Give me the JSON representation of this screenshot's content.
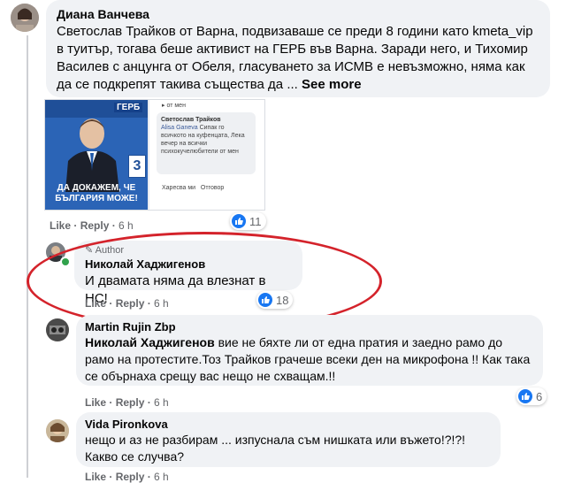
{
  "comment1": {
    "author": "Диана Ванчева",
    "text_main": "Светослав Трайков от Варна, подвизаваше се преди 8 години като kmeta_vip в туитър, тогава беше активист на ГЕРБ във Варна. Заради него, и Тихомир Василев с анцунга от Обеля, гласуването за ИСМВ е невъзможно, няма как да се подкрепят такива същества да ...",
    "see_more": "See more",
    "like": "Like",
    "reply": "Reply",
    "time": "6 h",
    "reactions": "11"
  },
  "attached_image": {
    "poster_logo": "ГЕРБ",
    "poster_slogan": "ДА ДОКАЖЕМ, ЧЕ БЪЛГАРИЯ МОЖЕ!",
    "poster_number": "3",
    "embedded_header": "от мен",
    "embedded_author": "Светослав Трайков",
    "embedded_mention": "Alisa Ganeva",
    "embedded_text": "Сипак го всичкото на куфенцата, Лека вечер на всички психокучелюбители от мен",
    "embedded_like": "Харесва ми",
    "embedded_reply": "Отговор"
  },
  "reply1": {
    "badge": "Author",
    "author": "Николай Хаджигенов",
    "text": "И двамата няма да влезнат в НС!",
    "like": "Like",
    "reply": "Reply",
    "time": "6 h",
    "reactions": "18"
  },
  "reply2": {
    "author": "Martin Rujin Zbp",
    "mention": "Николай Хаджигенов",
    "text": " вие не бяхте ли от една пратия и заедно рамо до рамо на протестите.Тоз Трайков грачеше всеки ден на микрофона !! Как така се обърнаха срещу вас нещо не схващам.!!",
    "like": "Like",
    "reply": "Reply",
    "time": "6 h",
    "reactions": "6"
  },
  "reply3": {
    "author": "Vida Pironkova",
    "text": "нещо и аз не разбирам ... изпуснала съм нишката или въжето!?!?! Какво се случва?",
    "like": "Like",
    "reply": "Reply",
    "time": "6 h"
  },
  "colors": {
    "bubble": "#f0f2f5",
    "meta": "#65676b",
    "like_blue": "#1877f2",
    "highlight": "#d4232b"
  }
}
